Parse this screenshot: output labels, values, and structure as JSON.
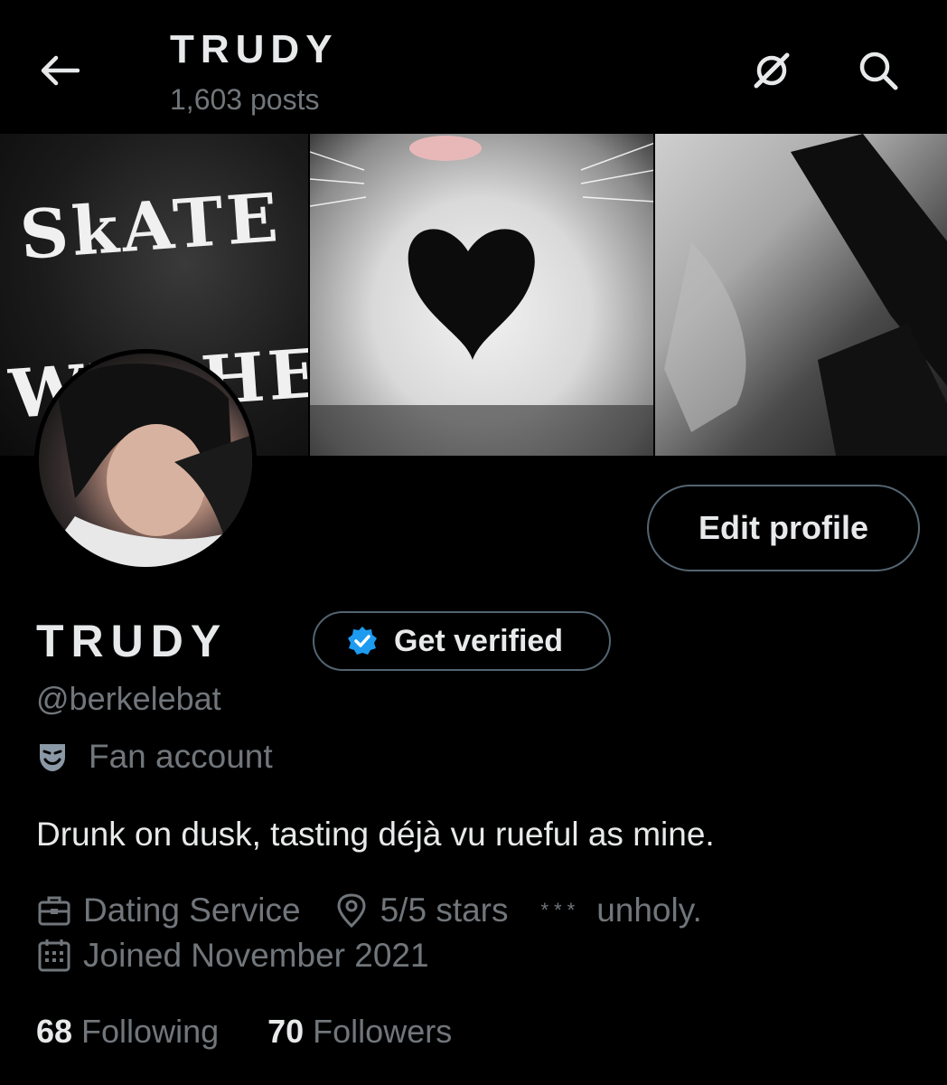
{
  "header": {
    "title": "TRUDY",
    "post_count": "1,603 posts",
    "back_icon": "arrow-left-icon",
    "ai_icon": "grok-slash-icon",
    "search_icon": "search-icon"
  },
  "banner": {
    "panel1_line1": "SkATE",
    "panel1_line2": "WItcHES"
  },
  "profile": {
    "edit_label": "Edit profile",
    "display_name": "TRUDY",
    "verify_label": "Get verified",
    "verify_color": "#1d9bf0",
    "handle": "@berkelebat",
    "category": "Fan account",
    "bio": "Drunk on dusk, tasting déjà vu rueful as mine.",
    "work": "Dating Service",
    "location": "5/5 stars",
    "stars": "***",
    "website": "unholy.",
    "joined": "Joined November 2021",
    "following_count": "68",
    "following_label": "Following",
    "followers_count": "70",
    "followers_label": "Followers"
  }
}
